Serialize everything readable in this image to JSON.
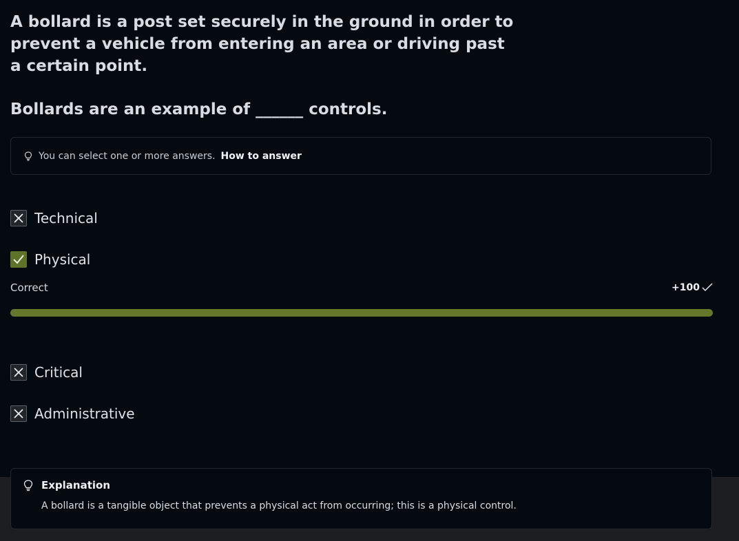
{
  "question": {
    "text": "A bollard is a post set securely in the ground in order to prevent a vehicle from entering an area or driving past a certain point.",
    "prompt": "Bollards are an example of ______ controls."
  },
  "hint": {
    "text": "You can select one or more answers.",
    "link": "How to answer"
  },
  "options": [
    {
      "label": "Technical",
      "state": "incorrect"
    },
    {
      "label": "Physical",
      "state": "correct"
    },
    {
      "label": "Critical",
      "state": "incorrect"
    },
    {
      "label": "Administrative",
      "state": "incorrect"
    }
  ],
  "result": {
    "label": "Correct",
    "points": "+100",
    "progress_fraction": 1.0
  },
  "explanation": {
    "title": "Explanation",
    "body": "A bollard is a tangible object that prevents a physical act from occurring; this is a physical control."
  },
  "colors": {
    "background": "#050910",
    "correct_green": "#5e7327",
    "bottom_band": "#1c1e21"
  },
  "icons": {
    "hint": "lightbulb-icon",
    "incorrect": "x-icon",
    "correct": "check-icon",
    "points": "checkmark-icon"
  }
}
